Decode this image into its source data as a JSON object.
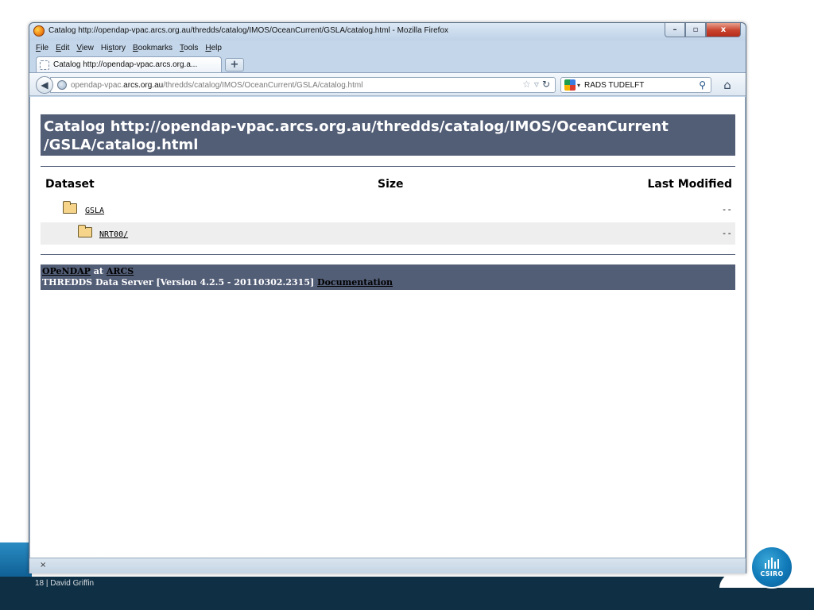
{
  "browser": {
    "window_title": "Catalog http://opendap-vpac.arcs.org.au/thredds/catalog/IMOS/OceanCurrent/GSLA/catalog.html - Mozilla Firefox",
    "controls": {
      "minimize": "–",
      "maximize": "▫",
      "close": "x"
    },
    "menu": [
      {
        "label": "File",
        "key": "F",
        "rest": "ile"
      },
      {
        "label": "Edit",
        "key": "E",
        "rest": "dit"
      },
      {
        "label": "View",
        "key": "V",
        "rest": "iew"
      },
      {
        "label": "History",
        "pre": "Hi",
        "key": "s",
        "rest": "tory"
      },
      {
        "label": "Bookmarks",
        "key": "B",
        "rest": "ookmarks"
      },
      {
        "label": "Tools",
        "key": "T",
        "rest": "ools"
      },
      {
        "label": "Help",
        "key": "H",
        "rest": "elp"
      }
    ],
    "tab": {
      "title": "Catalog http://opendap-vpac.arcs.org.a...",
      "new_tab": "+"
    },
    "url": {
      "prefix": "opendap-vpac.",
      "domain": "arcs.org.au",
      "path": "/thredds/catalog/IMOS/OceanCurrent/GSLA/catalog.html"
    },
    "search": {
      "engine_caret": "▾",
      "value": "RADS TUDELFT"
    },
    "status": {
      "close": "×"
    }
  },
  "page": {
    "header_line1": "Catalog http://opendap-vpac.arcs.org.au/thredds/catalog/IMOS/OceanCurrent",
    "header_line2": "/GSLA/catalog.html",
    "columns": {
      "dataset": "Dataset",
      "size": "Size",
      "modified": "Last Modified"
    },
    "rows": [
      {
        "name": "GSLA",
        "size": "",
        "modified": "--"
      },
      {
        "name": "NRT00/",
        "size": "",
        "modified": "--"
      }
    ],
    "footer": {
      "opendap": "OPeNDAP",
      "at": " at ",
      "arcs": "ARCS",
      "server": "THREDDS Data Server [Version 4.2.5 - 20110302.2315] ",
      "documentation": "Documentation"
    }
  },
  "slide": {
    "footer_text": "18 | David Griffin",
    "logo_text": "CSIRO",
    "accent_color": "#1079b8"
  }
}
